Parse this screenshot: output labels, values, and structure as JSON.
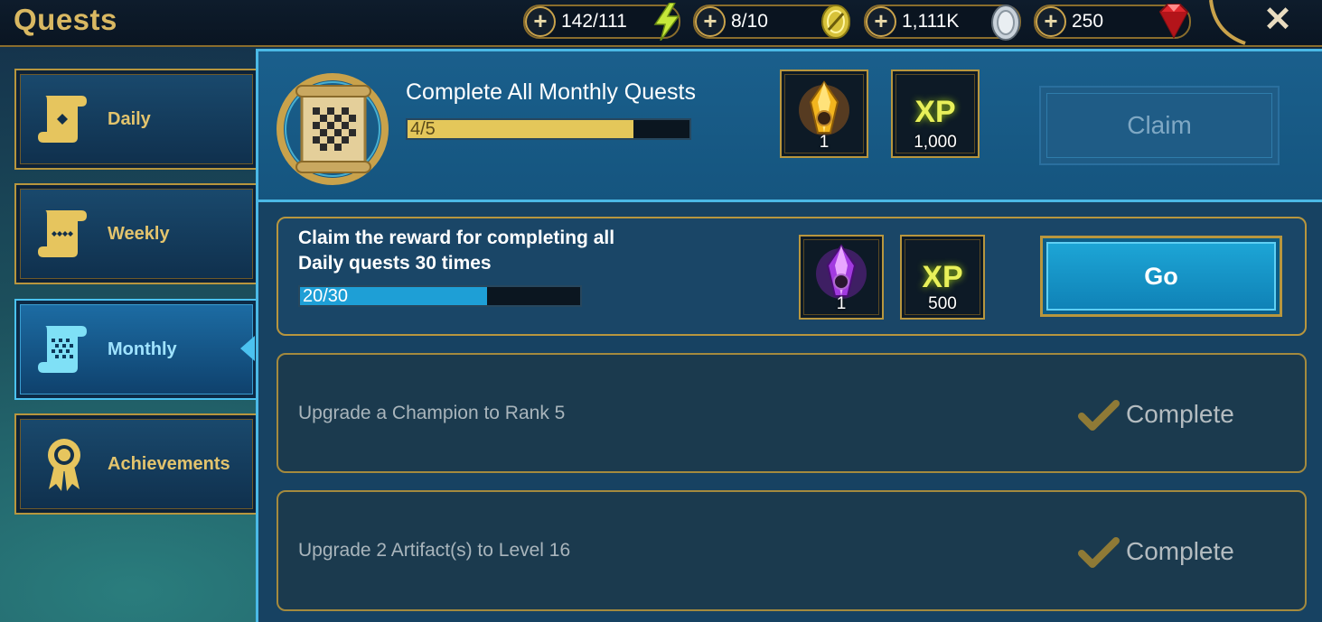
{
  "header": {
    "title": "Quests",
    "resources": [
      {
        "name": "energy",
        "value": "142/111",
        "icon": "lightning-icon"
      },
      {
        "name": "arena-tokens",
        "value": "8/10",
        "icon": "arena-token-icon"
      },
      {
        "name": "silver",
        "value": "1,111K",
        "icon": "silver-coin-icon"
      },
      {
        "name": "gems",
        "value": "250",
        "icon": "ruby-gem-icon"
      }
    ],
    "close_icon": "close-icon"
  },
  "sidebar": {
    "items": [
      {
        "label": "Daily",
        "icon": "daily-scroll-icon",
        "active": false
      },
      {
        "label": "Weekly",
        "icon": "weekly-scroll-icon",
        "active": false
      },
      {
        "label": "Monthly",
        "icon": "monthly-scroll-icon",
        "active": true
      },
      {
        "label": "Achievements",
        "icon": "award-ribbon-icon",
        "active": false
      }
    ]
  },
  "main": {
    "header_quest": {
      "title": "Complete All Monthly Quests",
      "progress_text": "4/5",
      "progress": 0.8,
      "rewards": [
        {
          "type": "shard",
          "icon": "ancient-shard-icon",
          "count": "1"
        },
        {
          "type": "xp",
          "icon_text": "XP",
          "count": "1,000"
        }
      ],
      "claim_label": "Claim"
    },
    "quests": [
      {
        "desc_line1": "Claim the reward for completing all",
        "desc_line2": "Daily quests 30 times",
        "progress_text": "20/30",
        "progress": 0.6667,
        "rewards": [
          {
            "type": "shard",
            "icon": "void-shard-icon",
            "count": "1"
          },
          {
            "type": "xp",
            "icon_text": "XP",
            "count": "500"
          }
        ],
        "action_label": "Go",
        "status": "in-progress"
      },
      {
        "desc": "Upgrade a Champion to Rank 5",
        "status_label": "Complete",
        "status": "complete"
      },
      {
        "desc": "Upgrade 2 Artifact(s) to Level 16",
        "status_label": "Complete",
        "status": "complete"
      }
    ]
  },
  "colors": {
    "gold": "#d9b862",
    "accent_blue": "#4bb9e6",
    "progress_gold": "#e4c75a",
    "progress_blue": "#1e9fd6"
  }
}
